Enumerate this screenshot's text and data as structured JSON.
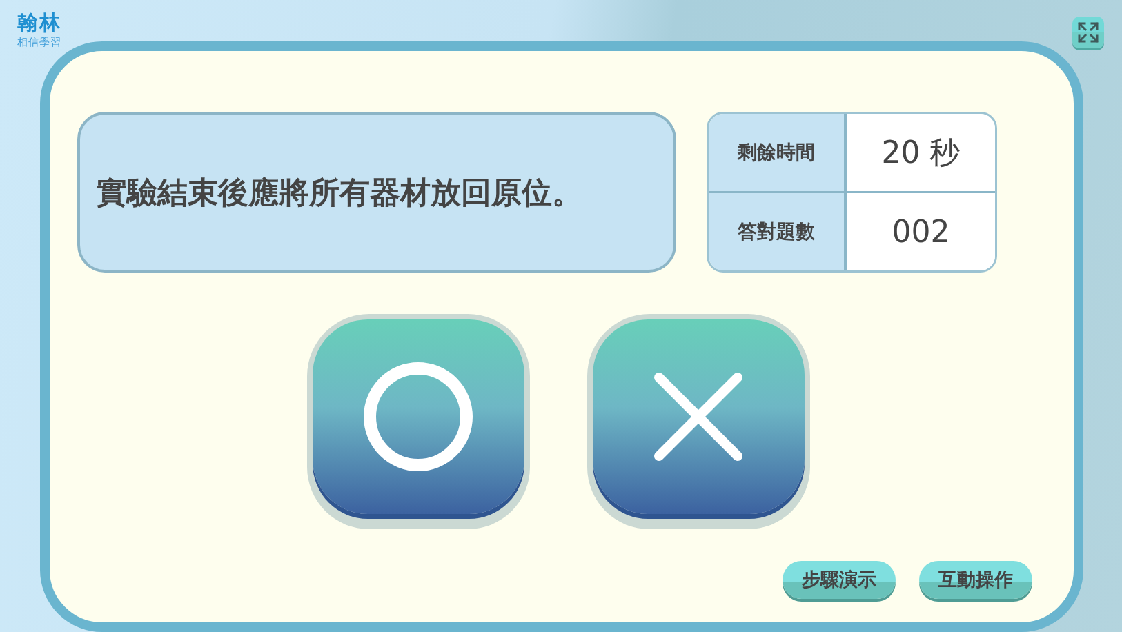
{
  "logo": {
    "name": "翰林",
    "tagline": "相信學習"
  },
  "question": "實驗結束後應將所有器材放回原位。",
  "stats": [
    {
      "label": "剩餘時間",
      "value": "20 秒"
    },
    {
      "label": "答對題數",
      "value": "002"
    }
  ],
  "answers": [
    {
      "kind": "circle"
    },
    {
      "kind": "cross"
    }
  ],
  "buttons": [
    "步驟演示",
    "互動操作"
  ]
}
